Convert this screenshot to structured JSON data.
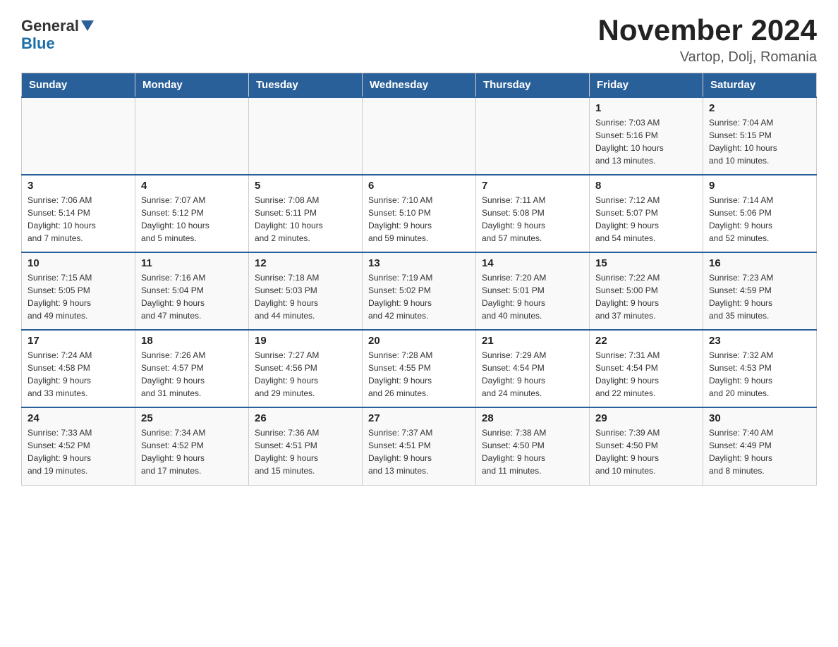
{
  "header": {
    "logo": {
      "general": "General",
      "blue": "Blue"
    },
    "title": "November 2024",
    "location": "Vartop, Dolj, Romania"
  },
  "weekdays": [
    "Sunday",
    "Monday",
    "Tuesday",
    "Wednesday",
    "Thursday",
    "Friday",
    "Saturday"
  ],
  "weeks": [
    [
      {
        "day": "",
        "info": ""
      },
      {
        "day": "",
        "info": ""
      },
      {
        "day": "",
        "info": ""
      },
      {
        "day": "",
        "info": ""
      },
      {
        "day": "",
        "info": ""
      },
      {
        "day": "1",
        "info": "Sunrise: 7:03 AM\nSunset: 5:16 PM\nDaylight: 10 hours\nand 13 minutes."
      },
      {
        "day": "2",
        "info": "Sunrise: 7:04 AM\nSunset: 5:15 PM\nDaylight: 10 hours\nand 10 minutes."
      }
    ],
    [
      {
        "day": "3",
        "info": "Sunrise: 7:06 AM\nSunset: 5:14 PM\nDaylight: 10 hours\nand 7 minutes."
      },
      {
        "day": "4",
        "info": "Sunrise: 7:07 AM\nSunset: 5:12 PM\nDaylight: 10 hours\nand 5 minutes."
      },
      {
        "day": "5",
        "info": "Sunrise: 7:08 AM\nSunset: 5:11 PM\nDaylight: 10 hours\nand 2 minutes."
      },
      {
        "day": "6",
        "info": "Sunrise: 7:10 AM\nSunset: 5:10 PM\nDaylight: 9 hours\nand 59 minutes."
      },
      {
        "day": "7",
        "info": "Sunrise: 7:11 AM\nSunset: 5:08 PM\nDaylight: 9 hours\nand 57 minutes."
      },
      {
        "day": "8",
        "info": "Sunrise: 7:12 AM\nSunset: 5:07 PM\nDaylight: 9 hours\nand 54 minutes."
      },
      {
        "day": "9",
        "info": "Sunrise: 7:14 AM\nSunset: 5:06 PM\nDaylight: 9 hours\nand 52 minutes."
      }
    ],
    [
      {
        "day": "10",
        "info": "Sunrise: 7:15 AM\nSunset: 5:05 PM\nDaylight: 9 hours\nand 49 minutes."
      },
      {
        "day": "11",
        "info": "Sunrise: 7:16 AM\nSunset: 5:04 PM\nDaylight: 9 hours\nand 47 minutes."
      },
      {
        "day": "12",
        "info": "Sunrise: 7:18 AM\nSunset: 5:03 PM\nDaylight: 9 hours\nand 44 minutes."
      },
      {
        "day": "13",
        "info": "Sunrise: 7:19 AM\nSunset: 5:02 PM\nDaylight: 9 hours\nand 42 minutes."
      },
      {
        "day": "14",
        "info": "Sunrise: 7:20 AM\nSunset: 5:01 PM\nDaylight: 9 hours\nand 40 minutes."
      },
      {
        "day": "15",
        "info": "Sunrise: 7:22 AM\nSunset: 5:00 PM\nDaylight: 9 hours\nand 37 minutes."
      },
      {
        "day": "16",
        "info": "Sunrise: 7:23 AM\nSunset: 4:59 PM\nDaylight: 9 hours\nand 35 minutes."
      }
    ],
    [
      {
        "day": "17",
        "info": "Sunrise: 7:24 AM\nSunset: 4:58 PM\nDaylight: 9 hours\nand 33 minutes."
      },
      {
        "day": "18",
        "info": "Sunrise: 7:26 AM\nSunset: 4:57 PM\nDaylight: 9 hours\nand 31 minutes."
      },
      {
        "day": "19",
        "info": "Sunrise: 7:27 AM\nSunset: 4:56 PM\nDaylight: 9 hours\nand 29 minutes."
      },
      {
        "day": "20",
        "info": "Sunrise: 7:28 AM\nSunset: 4:55 PM\nDaylight: 9 hours\nand 26 minutes."
      },
      {
        "day": "21",
        "info": "Sunrise: 7:29 AM\nSunset: 4:54 PM\nDaylight: 9 hours\nand 24 minutes."
      },
      {
        "day": "22",
        "info": "Sunrise: 7:31 AM\nSunset: 4:54 PM\nDaylight: 9 hours\nand 22 minutes."
      },
      {
        "day": "23",
        "info": "Sunrise: 7:32 AM\nSunset: 4:53 PM\nDaylight: 9 hours\nand 20 minutes."
      }
    ],
    [
      {
        "day": "24",
        "info": "Sunrise: 7:33 AM\nSunset: 4:52 PM\nDaylight: 9 hours\nand 19 minutes."
      },
      {
        "day": "25",
        "info": "Sunrise: 7:34 AM\nSunset: 4:52 PM\nDaylight: 9 hours\nand 17 minutes."
      },
      {
        "day": "26",
        "info": "Sunrise: 7:36 AM\nSunset: 4:51 PM\nDaylight: 9 hours\nand 15 minutes."
      },
      {
        "day": "27",
        "info": "Sunrise: 7:37 AM\nSunset: 4:51 PM\nDaylight: 9 hours\nand 13 minutes."
      },
      {
        "day": "28",
        "info": "Sunrise: 7:38 AM\nSunset: 4:50 PM\nDaylight: 9 hours\nand 11 minutes."
      },
      {
        "day": "29",
        "info": "Sunrise: 7:39 AM\nSunset: 4:50 PM\nDaylight: 9 hours\nand 10 minutes."
      },
      {
        "day": "30",
        "info": "Sunrise: 7:40 AM\nSunset: 4:49 PM\nDaylight: 9 hours\nand 8 minutes."
      }
    ]
  ]
}
